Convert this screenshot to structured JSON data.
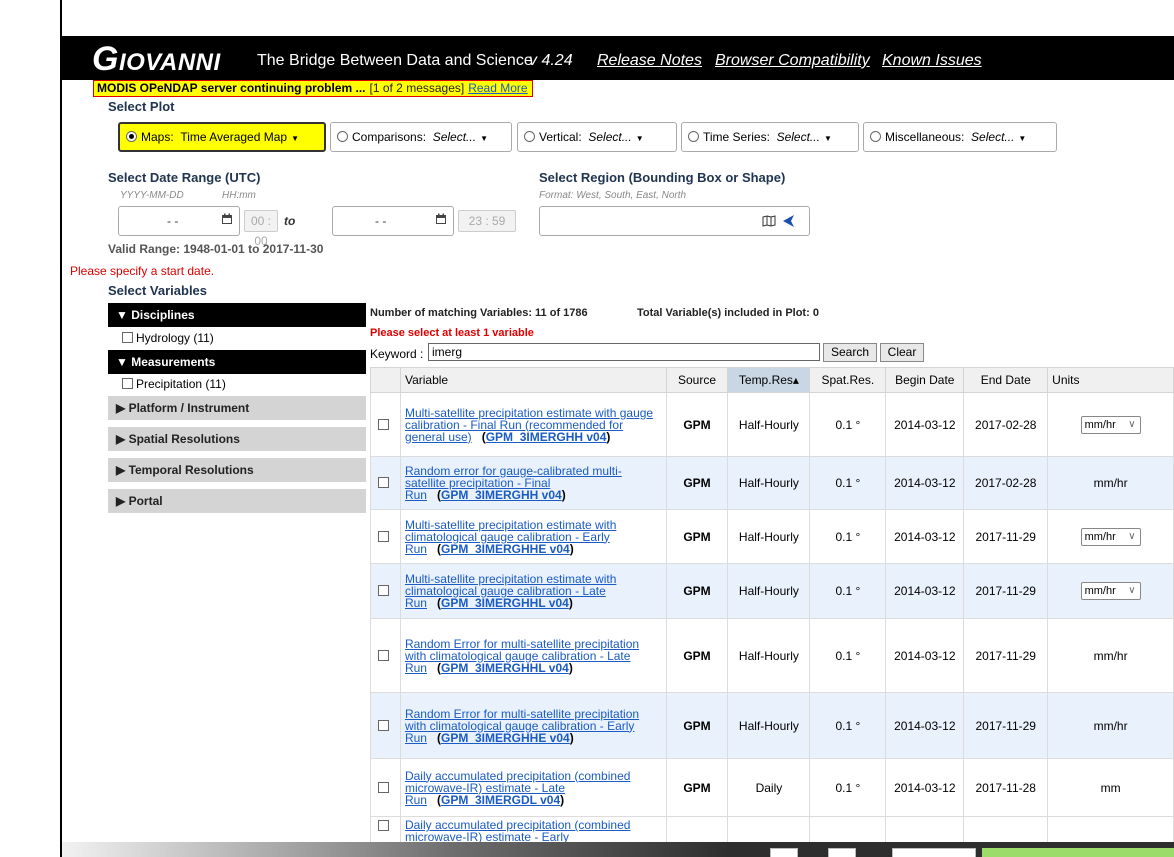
{
  "app": {
    "logo_big": "G",
    "logo_rest": "IOVANNI",
    "tagline": "The Bridge Between Data and Science",
    "version": "v 4.24",
    "links": [
      "Release Notes",
      "Browser Compatibility",
      "Known Issues"
    ]
  },
  "banner": {
    "message": "MODIS OPeNDAP server continuing problem ...",
    "count": "[1 of 2 messages]",
    "read_more": "Read More"
  },
  "select_plot": {
    "title": "Select Plot",
    "options": [
      {
        "label": "Maps:",
        "value": "Time Averaged Map",
        "selected": true
      },
      {
        "label": "Comparisons:",
        "value": "Select...",
        "selected": false
      },
      {
        "label": "Vertical:",
        "value": "Select...",
        "selected": false
      },
      {
        "label": "Time Series:",
        "value": "Select...",
        "selected": false
      },
      {
        "label": "Miscellaneous:",
        "value": "Select...",
        "selected": false
      }
    ]
  },
  "date_range": {
    "title": "Select Date Range (UTC)",
    "date_hint": "YYYY-MM-DD",
    "time_hint": "HH:mm",
    "start_date": "-   -",
    "start_time": "00 : 00",
    "to": "to",
    "end_date": "-   -",
    "end_time": "23 : 59",
    "valid_range": "Valid Range: 1948-01-01 to 2017-11-30",
    "error": "Please specify a start date."
  },
  "region": {
    "title": "Select Region (Bounding Box or Shape)",
    "hint": "Format: West, South, East, North",
    "value": ""
  },
  "variables": {
    "title": "Select Variables",
    "facets": {
      "disciplines": {
        "label": "▼ Disciplines",
        "item": "Hydrology (11)"
      },
      "measurements": {
        "label": "▼ Measurements",
        "item": "Precipitation (11)"
      },
      "collapsed": [
        "▶ Platform / Instrument",
        "▶ Spatial Resolutions",
        "▶ Temporal Resolutions",
        "▶ Portal"
      ]
    },
    "matching": "Number of matching Variables: 11 of 1786",
    "total": "Total Variable(s) included in Plot: 0",
    "error": "Please select at least 1 variable",
    "keyword_label": "Keyword :",
    "keyword_value": "imerg",
    "search_label": "Search",
    "clear_label": "Clear",
    "columns": [
      "Variable",
      "Source",
      "Temp.Res▴",
      "Spat.Res.",
      "Begin Date",
      "End Date",
      "Units"
    ],
    "rows": [
      {
        "name": "Multi-satellite precipitation estimate with gauge calibration - Final Run (recommended for general use)",
        "id": "GPM_3IMERGHH v04",
        "source": "GPM",
        "temp": "Half-Hourly",
        "spat": "0.1 °",
        "begin": "2014-03-12",
        "end": "2017-02-28",
        "units": "mm/hr",
        "units_select": true
      },
      {
        "name": "Random error for gauge-calibrated multi-satellite precipitation - Final Run",
        "id": "GPM_3IMERGHH v04",
        "source": "GPM",
        "temp": "Half-Hourly",
        "spat": "0.1 °",
        "begin": "2014-03-12",
        "end": "2017-02-28",
        "units": "mm/hr",
        "units_select": false
      },
      {
        "name": "Multi-satellite precipitation estimate with climatological gauge calibration - Early Run",
        "id": "GPM_3IMERGHHE v04",
        "source": "GPM",
        "temp": "Half-Hourly",
        "spat": "0.1 °",
        "begin": "2014-03-12",
        "end": "2017-11-29",
        "units": "mm/hr",
        "units_select": true
      },
      {
        "name": "Multi-satellite precipitation estimate with climatological gauge calibration - Late Run",
        "id": "GPM_3IMERGHHL v04",
        "source": "GPM",
        "temp": "Half-Hourly",
        "spat": "0.1 °",
        "begin": "2014-03-12",
        "end": "2017-11-29",
        "units": "mm/hr",
        "units_select": true
      },
      {
        "name": "Random Error for multi-satellite precipitation with climatological gauge calibration - Late Run",
        "id": "GPM_3IMERGHHL v04",
        "source": "GPM",
        "temp": "Half-Hourly",
        "spat": "0.1 °",
        "begin": "2014-03-12",
        "end": "2017-11-29",
        "units": "mm/hr",
        "units_select": false
      },
      {
        "name": "Random Error for multi-satellite precipitation with climatological gauge calibration - Early Run",
        "id": "GPM_3IMERGHHE v04",
        "source": "GPM",
        "temp": "Half-Hourly",
        "spat": "0.1 °",
        "begin": "2014-03-12",
        "end": "2017-11-29",
        "units": "mm/hr",
        "units_select": false
      },
      {
        "name": "Daily accumulated precipitation (combined microwave-IR) estimate - Late Run",
        "id": "GPM_3IMERGDL v04",
        "source": "GPM",
        "temp": "Daily",
        "spat": "0.1 °",
        "begin": "2014-03-12",
        "end": "2017-11-28",
        "units": "mm",
        "units_select": false
      },
      {
        "name": "Daily accumulated precipitation (combined microwave-IR) estimate - Early",
        "id": "",
        "source": "",
        "temp": "",
        "spat": "",
        "begin": "",
        "end": "",
        "units": "",
        "units_select": false
      }
    ]
  },
  "colors": {
    "banner_bg": "#ffff00",
    "link": "#1a5bc4",
    "error": "#e00000",
    "row_alt": "#e9f1fc",
    "header_bg": "#000000"
  }
}
